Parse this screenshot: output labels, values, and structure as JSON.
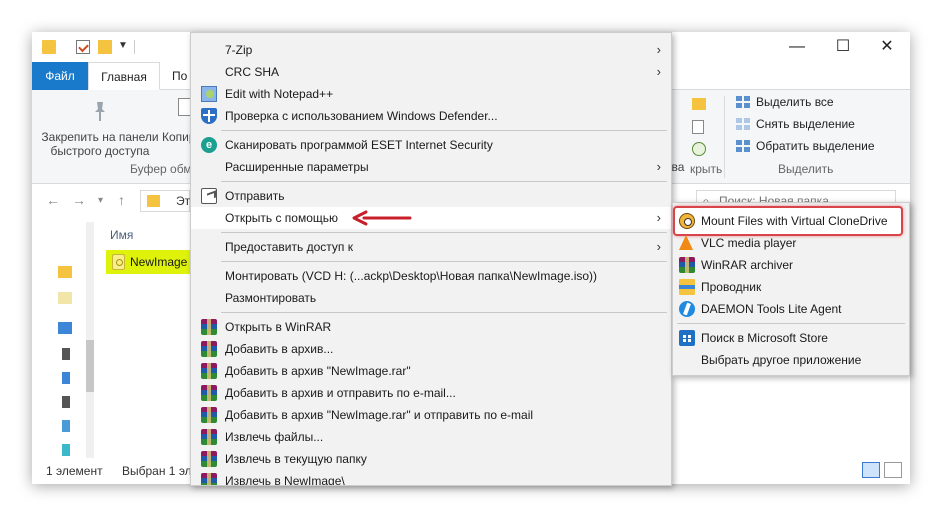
{
  "window": {
    "controls": {
      "minimize": "—",
      "maximize": "☐",
      "close": "✕"
    }
  },
  "ribbon": {
    "tabs": {
      "file": "Файл",
      "home": "Главная",
      "share": "По"
    },
    "pin_label": "Закрепить на панели быстрого доступа",
    "copy_label": "Копир",
    "clipboard_group": "Буфер обм",
    "open_group_fragment": "крыть",
    "open_fragment": "тва",
    "select_all": "Выделить все",
    "select_none": "Снять выделение",
    "invert_selection": "Обратить выделение",
    "select_group": "Выделить"
  },
  "address": {
    "path_fragment": "Эт",
    "search_placeholder": "Поиск: Новая папка"
  },
  "file_list": {
    "column_name": "Имя",
    "files": [
      {
        "name": "NewImage"
      }
    ]
  },
  "status": {
    "count": "1 элемент",
    "selected": "Выбран 1 эл"
  },
  "context_menu": {
    "items": [
      {
        "label": "7-Zip",
        "submenu": true
      },
      {
        "label": "CRC SHA",
        "submenu": true
      },
      {
        "label": "Edit with Notepad++",
        "icon": "notepad-plus-plus-icon"
      },
      {
        "label": "Проверка с использованием Windows Defender...",
        "icon": "windows-defender-icon"
      },
      {
        "label": "Сканировать программой ESET Internet Security",
        "icon": "eset-icon"
      },
      {
        "label": "Расширенные параметры",
        "submenu": true
      },
      {
        "label": "Отправить",
        "icon": "share-icon"
      },
      {
        "label": "Открыть с помощью",
        "submenu": true,
        "highlighted": true
      },
      {
        "label": "Предоставить доступ к",
        "submenu": true
      },
      {
        "label": "Монтировать (VCD H: (...ackp\\Desktop\\Новая папка\\NewImage.iso))"
      },
      {
        "label": "Размонтировать"
      },
      {
        "label": "Открыть в WinRAR",
        "icon": "winrar-icon"
      },
      {
        "label": "Добавить в архив...",
        "icon": "winrar-icon"
      },
      {
        "label": "Добавить в архив \"NewImage.rar\"",
        "icon": "winrar-icon"
      },
      {
        "label": "Добавить в архив и отправить по e-mail...",
        "icon": "winrar-icon"
      },
      {
        "label": "Добавить в архив \"NewImage.rar\" и отправить по e-mail",
        "icon": "winrar-icon"
      },
      {
        "label": "Извлечь файлы...",
        "icon": "winrar-icon"
      },
      {
        "label": "Извлечь в текущую папку",
        "icon": "winrar-icon"
      },
      {
        "label": "Извлечь в NewImage\\",
        "icon": "winrar-icon"
      }
    ]
  },
  "open_with_menu": {
    "items": [
      {
        "label": "Mount Files with Virtual CloneDrive",
        "icon": "virtual-clonedrive-icon",
        "highlighted": true
      },
      {
        "label": "VLC media player",
        "icon": "vlc-icon"
      },
      {
        "label": "WinRAR archiver",
        "icon": "winrar-icon"
      },
      {
        "label": "Проводник",
        "icon": "file-explorer-icon"
      },
      {
        "label": "DAEMON Tools Lite Agent",
        "icon": "daemon-tools-icon"
      },
      {
        "label": "Поиск в Microsoft Store",
        "icon": "microsoft-store-icon"
      },
      {
        "label": "Выбрать другое приложение"
      }
    ]
  },
  "colors": {
    "accent": "#1979ca",
    "highlight_box": "#d9434a",
    "selected_file": "#dff20a"
  }
}
